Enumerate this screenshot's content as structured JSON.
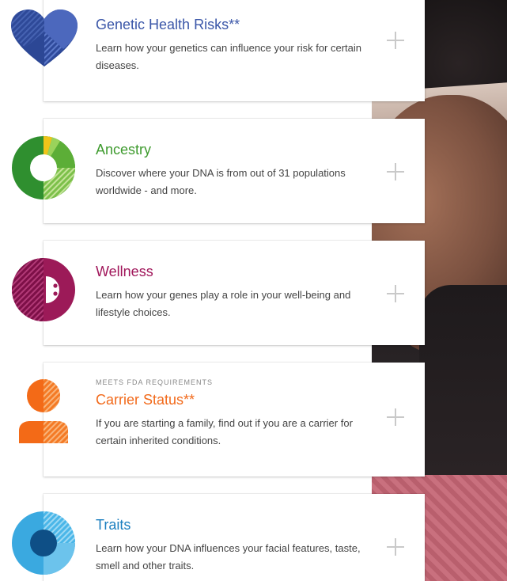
{
  "cards": [
    {
      "eyebrow": "",
      "title": "Genetic Health Risks**",
      "description": "Learn how your genetics can influence your risk for certain diseases.",
      "color": "#3a56a8"
    },
    {
      "eyebrow": "",
      "title": "Ancestry",
      "description": "Discover where your DNA is from out of 31 populations worldwide - and more.",
      "color": "#3f9b2f"
    },
    {
      "eyebrow": "",
      "title": "Wellness",
      "description": "Learn how your genes play a role in your well-being and lifestyle choices.",
      "color": "#a0165a"
    },
    {
      "eyebrow": "MEETS FDA REQUIREMENTS",
      "title": "Carrier Status**",
      "description": "If you are starting a family, find out if you are a carrier for certain inherited conditions.",
      "color": "#f26a1b"
    },
    {
      "eyebrow": "",
      "title": "Traits",
      "description": "Learn how your DNA influences your facial features, taste, smell and other traits.",
      "color": "#1c7fbf"
    }
  ],
  "icons": [
    "heart-icon",
    "donut-chart-icon",
    "wellness-circle-icon",
    "person-icon",
    "circle-target-icon"
  ]
}
